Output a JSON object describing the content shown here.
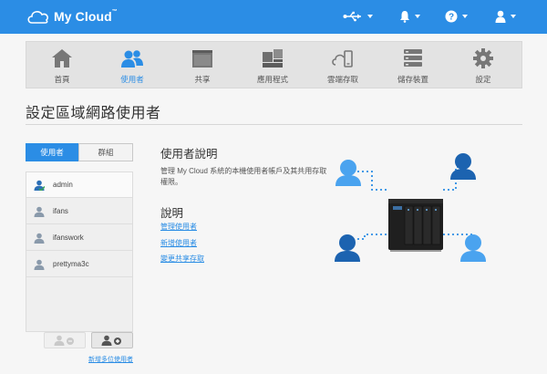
{
  "app": {
    "brand": "My Cloud",
    "brand_mark": "™"
  },
  "colors": {
    "accent": "#2b8de5",
    "user_dark": "#1c63b0",
    "user_light": "#4aa3ef"
  },
  "header_icons": [
    "usb-icon",
    "bell-icon",
    "help-icon",
    "user-icon"
  ],
  "nav": [
    {
      "label": "首頁",
      "icon": "home-icon"
    },
    {
      "label": "使用者",
      "icon": "users-icon",
      "active": true
    },
    {
      "label": "共享",
      "icon": "folder-icon"
    },
    {
      "label": "應用程式",
      "icon": "apps-icon"
    },
    {
      "label": "雲端存取",
      "icon": "cloud-access-icon"
    },
    {
      "label": "儲存裝置",
      "icon": "storage-icon"
    },
    {
      "label": "設定",
      "icon": "gear-icon"
    }
  ],
  "page": {
    "title": "設定區域網路使用者"
  },
  "segment": {
    "users_label": "使用者",
    "groups_label": "群組"
  },
  "users": [
    {
      "name": "admin",
      "admin": true
    },
    {
      "name": "ifans"
    },
    {
      "name": "ifanswork"
    },
    {
      "name": "prettyma3c"
    }
  ],
  "actions": {
    "multi_link": "新增多位使用者"
  },
  "info": {
    "heading": "使用者說明",
    "description": "管理 My Cloud 系統的本機使用者帳戶及其共用存取權限。",
    "notes_heading": "說明",
    "links": [
      "管理使用者",
      "新增使用者",
      "變更共享存取"
    ]
  }
}
